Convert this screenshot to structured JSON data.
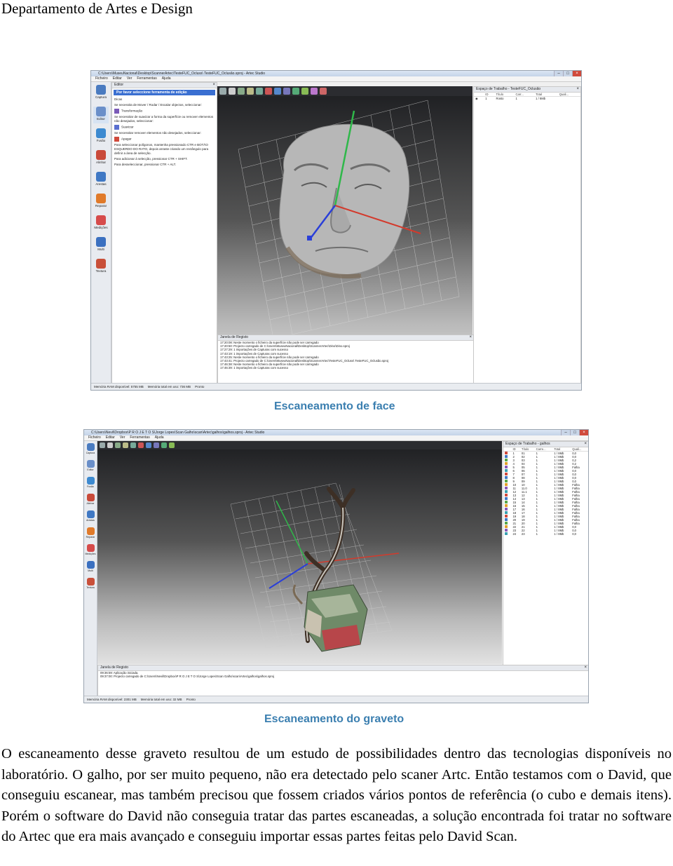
{
  "header": {
    "title": "Departamento de Artes e Design"
  },
  "figure1": {
    "caption": "Escaneamento de face",
    "window_title": "C:\\Users\\MuseuNacional\\Desktop\\ScannerArtec\\TesteFUC_Ocluss\\ TesteFUC_Oclusão.sproj - Artec Studio",
    "menu": [
      "Ficheiro",
      "Editar",
      "Ver",
      "Ferramentas",
      "Ajuda"
    ],
    "tools": [
      "Captura",
      "Editor",
      "Fusão",
      "Alinhar",
      "Arestas",
      "Reparar",
      "Medições",
      "Multi",
      "Textura"
    ],
    "editor": {
      "header": "Editor",
      "highlight": "Por favor seleccione ferramenta de edição",
      "items": [
        "Dicas",
        "Se necessita de Mover / Rodar / Escalar objectos, seleccionar:",
        "Transformação",
        "Se necessitar de suavizar a forma da superfície ou remover elementos não desejados, seleccionar:",
        "Suavizar",
        "Se necessitar remover elementos não desejados, seleccionar:",
        "Apagar",
        "Para seleccionar polígonos, mantenha pressionado CTR e BOTÃO ESQUERDO DO RATO, depois arraste criando um rectângulo para definir a área de selecção.",
        "Para adicionar à selecção, pressionar CTR + SHIFT.",
        "Para desseleccionar, pressionar CTR + ALT."
      ]
    },
    "workspace": {
      "header": "Espaço de Trabalho - TesteFUC_Oclusão",
      "columns": [
        "ID",
        "Título",
        "Carr...",
        "Total",
        "Quali..."
      ],
      "rows": [
        [
          "1",
          "Rosto",
          "1",
          "1 / 8Mb",
          ""
        ]
      ]
    },
    "log": {
      "header": "Janela de Registo",
      "lines": [
        "17:20:08: Neste momento o ficheiro da superfície não pode ser carregado",
        "17:20:50: Projecto carregado de C:\\Users\\MuseuNacional\\Desktop\\ScannerArtec\\Dino\\Dino.sproj",
        "17:27:29: 1 importações de Capturas com sucesso",
        "17:43:19: 1 importações de Capturas com sucesso",
        "17:43:25: Neste momento o ficheiro da superfície não pode ser carregado",
        "17:43:41: Projecto carregado de C:\\Users\\MuseuNacional\\Desktop\\ScannerArtec\\TesteFUC_Ocluss\\ TesteFUC_Oclusão.sproj",
        "17:46:38: Neste momento o ficheiro da superfície não pode ser carregado",
        "17:46:39: 1 importações de Capturas com sucesso"
      ]
    },
    "status": [
      "Memória RAM disponível: 5755 MB",
      "Memória total em uso: 736 MB",
      "Pronto"
    ]
  },
  "figure2": {
    "caption": "Escaneamento do graveto",
    "window_title": "C:\\Users\\Nevil\\Dropbox\\P R O J E T O S\\Jorge Lopes\\Scan Galho\\scan\\Artec\\galhos\\galhos.sproj - Artec Studio",
    "menu": [
      "Ficheiro",
      "Editar",
      "Ver",
      "Ferramentas",
      "Ajuda"
    ],
    "tools": [
      "Captura",
      "Editor",
      "Fusão",
      "Alinhar",
      "Arestas",
      "Reparar",
      "Medições",
      "Multi",
      "Textura"
    ],
    "workspace": {
      "header": "Espaço de Trabalho - galhos",
      "columns": [
        "ID",
        "Título",
        "Carre...",
        "Total",
        "Quali..."
      ],
      "rows": [
        [
          "1",
          "01",
          "1",
          "1 / 8Mb",
          "0,0"
        ],
        [
          "2",
          "02",
          "1",
          "1 / 8Mb",
          "0,0"
        ],
        [
          "3",
          "03",
          "1",
          "1 / 8Mb",
          "0,2"
        ],
        [
          "4",
          "04",
          "1",
          "1 / 8Mb",
          "0,2"
        ],
        [
          "5",
          "05",
          "1",
          "1 / 8Mb",
          "Falha"
        ],
        [
          "6",
          "06",
          "1",
          "1 / 8Mb",
          "0,0"
        ],
        [
          "7",
          "07",
          "1",
          "1 / 8Mb",
          "0,0"
        ],
        [
          "8",
          "08",
          "1",
          "1 / 8Mb",
          "0,0"
        ],
        [
          "9",
          "09",
          "1",
          "1 / 8Mb",
          "0,0"
        ],
        [
          "10",
          "10",
          "1",
          "1 / 8Mb",
          "Falha"
        ],
        [
          "11",
          "11.0",
          "1",
          "1 / 8Mb",
          "Falha"
        ],
        [
          "12",
          "11.1",
          "1",
          "1 / 8Mb",
          "Falha"
        ],
        [
          "13",
          "12",
          "1",
          "1 / 8Mb",
          "Falha"
        ],
        [
          "14",
          "13",
          "1",
          "1 / 8Mb",
          "Falha"
        ],
        [
          "15",
          "14",
          "1",
          "1 / 8Mb",
          "Falha"
        ],
        [
          "16",
          "15",
          "1",
          "1 / 8Mb",
          "Falha"
        ],
        [
          "17",
          "16",
          "1",
          "1 / 8Mb",
          "Falha"
        ],
        [
          "18",
          "17",
          "1",
          "1 / 8Mb",
          "Falha"
        ],
        [
          "19",
          "18",
          "1",
          "1 / 8Mb",
          "Falha"
        ],
        [
          "20",
          "19",
          "1",
          "1 / 8Mb",
          "Falha"
        ],
        [
          "21",
          "20",
          "1",
          "1 / 8Mb",
          "Falha"
        ],
        [
          "22",
          "21",
          "1",
          "1 / 8Mb",
          "0,0"
        ],
        [
          "23",
          "22",
          "1",
          "1 / 8Mb",
          "0,0"
        ],
        [
          "24",
          "23",
          "1",
          "1 / 8Mb",
          "0,0"
        ]
      ]
    },
    "log": {
      "header": "Janela de Registo",
      "lines": [
        "09:36:59: Aplicação iniciada.",
        "09:37:00: Projecto carregado de C:\\Users\\Nevil\\Dropbox\\P R O J E T O S\\Jorge Lopes\\Scan Galho\\scan\\Artec\\galhos\\galhos.sproj"
      ]
    },
    "status": [
      "Memória RAM disponível: 2301 MB",
      "Memória total em uso: 32 MB",
      "Pronto"
    ]
  },
  "body_text": "O escaneamento desse graveto resultou de um estudo de possibilidades dentro das tecnologias disponíveis no laboratório. O galho, por ser muito pequeno, não era detectado pelo scaner Artc. Então testamos com o David, que conseguiu escanear, mas também precisou que fossem criados vários pontos de referência (o cubo e demais itens). Porém o software do David não conseguia tratar das partes escaneadas, a solução encontrada foi tratar no software do Artec que era mais avançado e conseguiu importar essas partes feitas pelo David Scan.",
  "colors": {
    "caption": "#3b7fb0",
    "highlight": "#3a6fd1",
    "axis_x": "#d33a2c",
    "axis_y": "#2fb84a",
    "axis_z": "#2a3fd8"
  }
}
